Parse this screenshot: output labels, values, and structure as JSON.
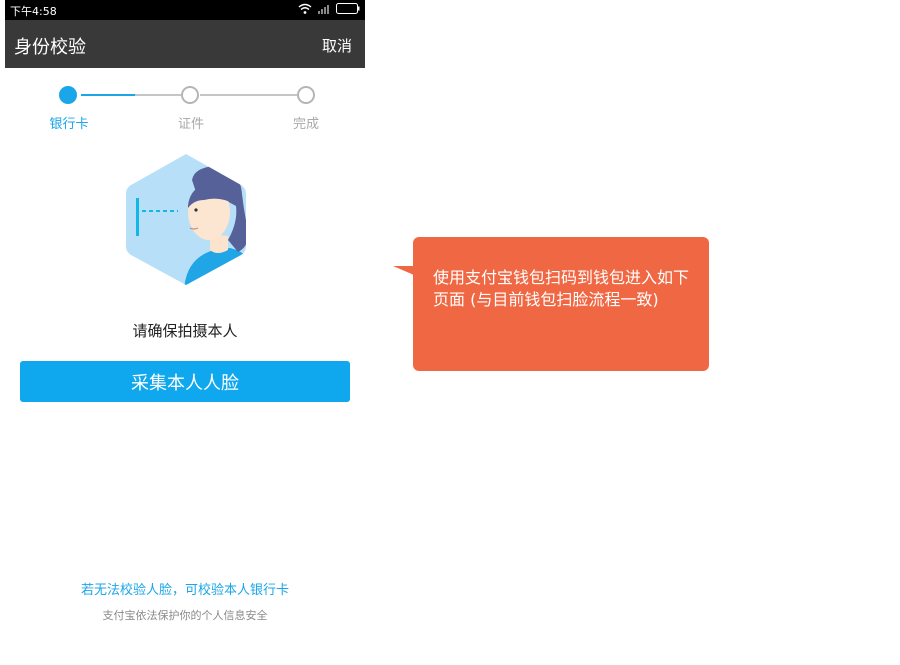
{
  "status_bar": {
    "time": "下午4:58"
  },
  "nav": {
    "title": "身份校验",
    "cancel_label": "取消"
  },
  "stepper": {
    "steps": [
      {
        "label": "银行卡",
        "state": "active"
      },
      {
        "label": "证件",
        "state": "inactive"
      },
      {
        "label": "完成",
        "state": "inactive"
      }
    ]
  },
  "main": {
    "instruction": "请确保拍摄本人",
    "capture_button_label": "采集本人人脸",
    "alt_link": "若无法校验人脸，可校验本人银行卡",
    "footer_note": "支付宝依法保护你的个人信息安全"
  },
  "callout": {
    "text": "使用支付宝钱包扫码到钱包进入如下页面 (与目前钱包扫脸流程一致)"
  },
  "colors": {
    "accent": "#1aa6e8",
    "nav_bg": "#393939",
    "button_bg": "#0fa7ee",
    "callout_bg": "#f06843"
  }
}
